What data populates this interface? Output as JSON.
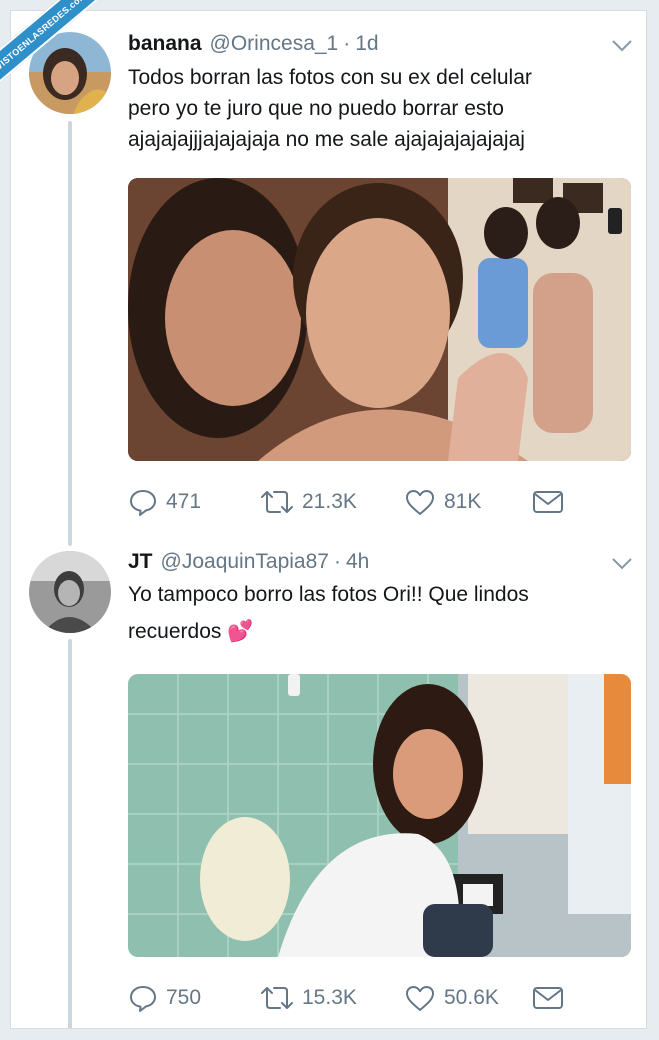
{
  "watermark": "VISTOENLASREDES.com",
  "tweets": [
    {
      "name": "banana",
      "handle": "@Orincesa_1",
      "separator": "·",
      "time": "1d",
      "text_lines": [
        "Todos borran las fotos con su ex del celular",
        "pero yo te juro que no puedo borrar esto",
        "ajajajajjjajajajaja no me sale ajajajajajajajaj"
      ],
      "image": "selfie-photo",
      "replies": "471",
      "retweets": "21.3K",
      "likes": "81K"
    },
    {
      "name": "JT",
      "handle": "@JoaquinTapia87",
      "separator": "·",
      "time": "4h",
      "text_lines": [
        "Yo tampoco borro las fotos Ori!! Que lindos",
        "recuerdos"
      ],
      "emoji": "💕",
      "image": "bathroom-photo",
      "replies": "750",
      "retweets": "15.3K",
      "likes": "50.6K"
    }
  ],
  "colors": {
    "background": "#e6ecf0",
    "card": "#ffffff",
    "secondary_text": "#657786",
    "thread_line": "#ccd6dd",
    "watermark": "#2e8fc9"
  },
  "icons": [
    "reply-icon",
    "retweet-icon",
    "like-icon",
    "direct-message-icon",
    "chevron-down-icon"
  ]
}
